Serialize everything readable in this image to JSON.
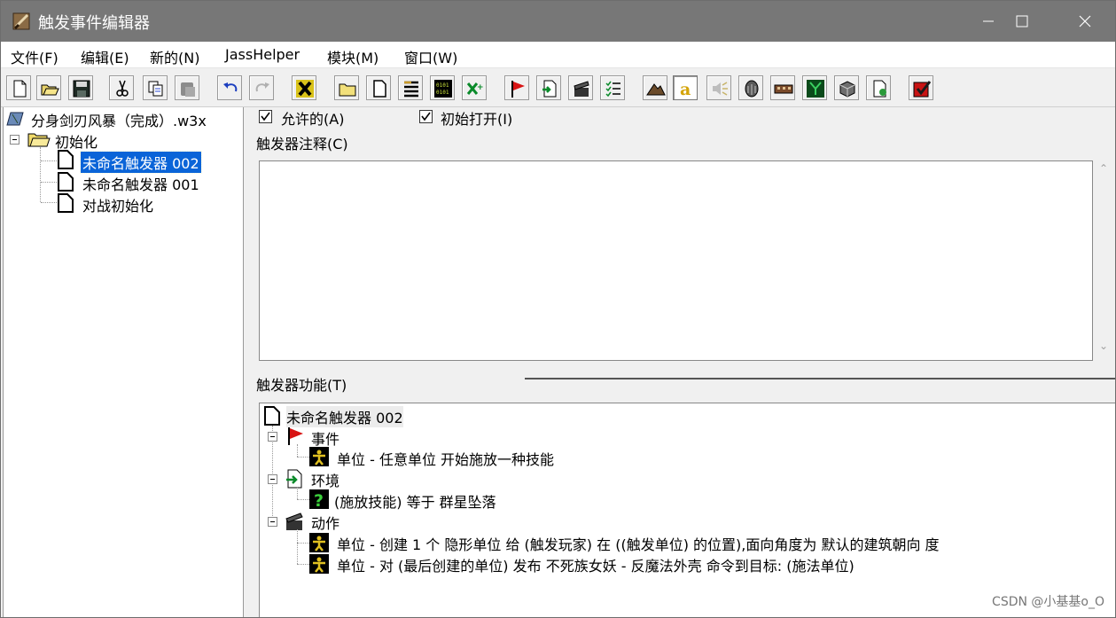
{
  "window": {
    "title": "触发事件编辑器"
  },
  "menu": [
    "文件(F)",
    "编辑(E)",
    "新的(N)",
    "JassHelper",
    "模块(M)",
    "窗口(W)"
  ],
  "toolbar_icons": [
    "new-doc-icon",
    "open-folder-icon",
    "save-icon",
    "cut-icon",
    "copy-icon",
    "paste-icon",
    "undo-icon",
    "redo-icon",
    "x-tool-icon",
    "new-category-icon",
    "new-trigger-icon",
    "new-comment-icon",
    "script-icon",
    "variables-icon",
    "flag-icon",
    "import-icon",
    "clapper-icon",
    "checklist-icon",
    "terrain-icon",
    "text-a-icon",
    "sound-icon",
    "portrait-icon",
    "object-icon",
    "ai-icon",
    "import-manager-icon",
    "test-map-icon",
    "validate-icon"
  ],
  "tree": {
    "root": "分身剑刃风暴（完成）.w3x",
    "category": "初始化",
    "items": [
      "未命名触发器 002",
      "未命名触发器 001",
      "对战初始化"
    ]
  },
  "options": {
    "enabled": "允许的(A)",
    "initially_on": "初始打开(I)"
  },
  "comment_label": "触发器注释(C)",
  "functions_label": "触发器功能(T)",
  "trigger": {
    "name": "未命名触发器 002",
    "events_label": "事件",
    "event": "单位 - 任意单位 开始施放一种技能",
    "conditions_label": "环境",
    "condition": "(施放技能) 等于 群星坠落",
    "actions_label": "动作",
    "action1": "单位 - 创建 1 个 隐形单位 给 (触发玩家) 在 ((触发单位) 的位置),面向角度为 默认的建筑朝向 度",
    "action2": "单位 - 对 (最后创建的单位) 发布 不死族女妖 - 反魔法外壳 命令到目标: (施法单位)"
  },
  "watermark": "CSDN @小基基o_O"
}
